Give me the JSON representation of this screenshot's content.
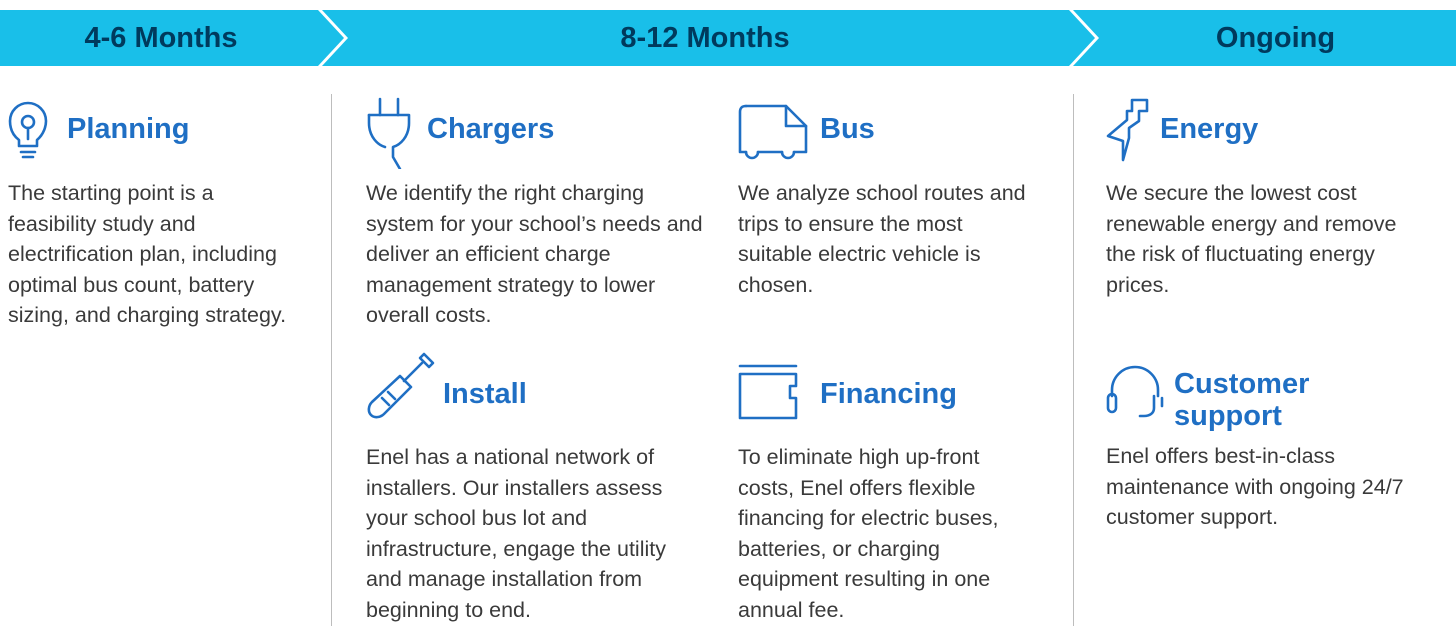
{
  "colors": {
    "phase_bar": "#19bfe9",
    "phase_text": "#003a5d",
    "title": "#1f6fc4",
    "icon": "#1f6fc4",
    "body_text": "#3a3a3a"
  },
  "phases": [
    "4-6 Months",
    "8-12 Months",
    "Ongoing"
  ],
  "sections": {
    "planning": {
      "icon": "lightbulb-icon",
      "title": "Planning",
      "body": "The starting point is a feasibility study and electrification plan, including optimal bus count, battery sizing, and charging strategy."
    },
    "chargers": {
      "icon": "plug-icon",
      "title": "Chargers",
      "body": "We identify the right charging system for your school’s needs and deliver an efficient charge management strategy to lower overall costs."
    },
    "bus": {
      "icon": "bus-icon",
      "title": "Bus",
      "body": "We analyze school routes and trips to ensure the most suitable electric vehicle is chosen."
    },
    "energy": {
      "icon": "lightning-bolt-icon",
      "title": "Energy",
      "body": "We secure the lowest cost renewable energy and remove the risk of fluctuating energy prices."
    },
    "install": {
      "icon": "screwdriver-icon",
      "title": "Install",
      "body": "Enel has a national network of installers. Our installers assess your school bus lot and infrastructure, engage the utility and manage installation from beginning to end."
    },
    "financing": {
      "icon": "wallet-icon",
      "title": "Financing",
      "body": "To eliminate high up-front costs, Enel offers flexible financing for electric buses, batteries, or charging equipment resulting in one annual fee."
    },
    "support": {
      "icon": "headset-icon",
      "title": "Customer support",
      "body": "Enel offers best-in-class maintenance with ongoing 24/7 customer support."
    }
  }
}
